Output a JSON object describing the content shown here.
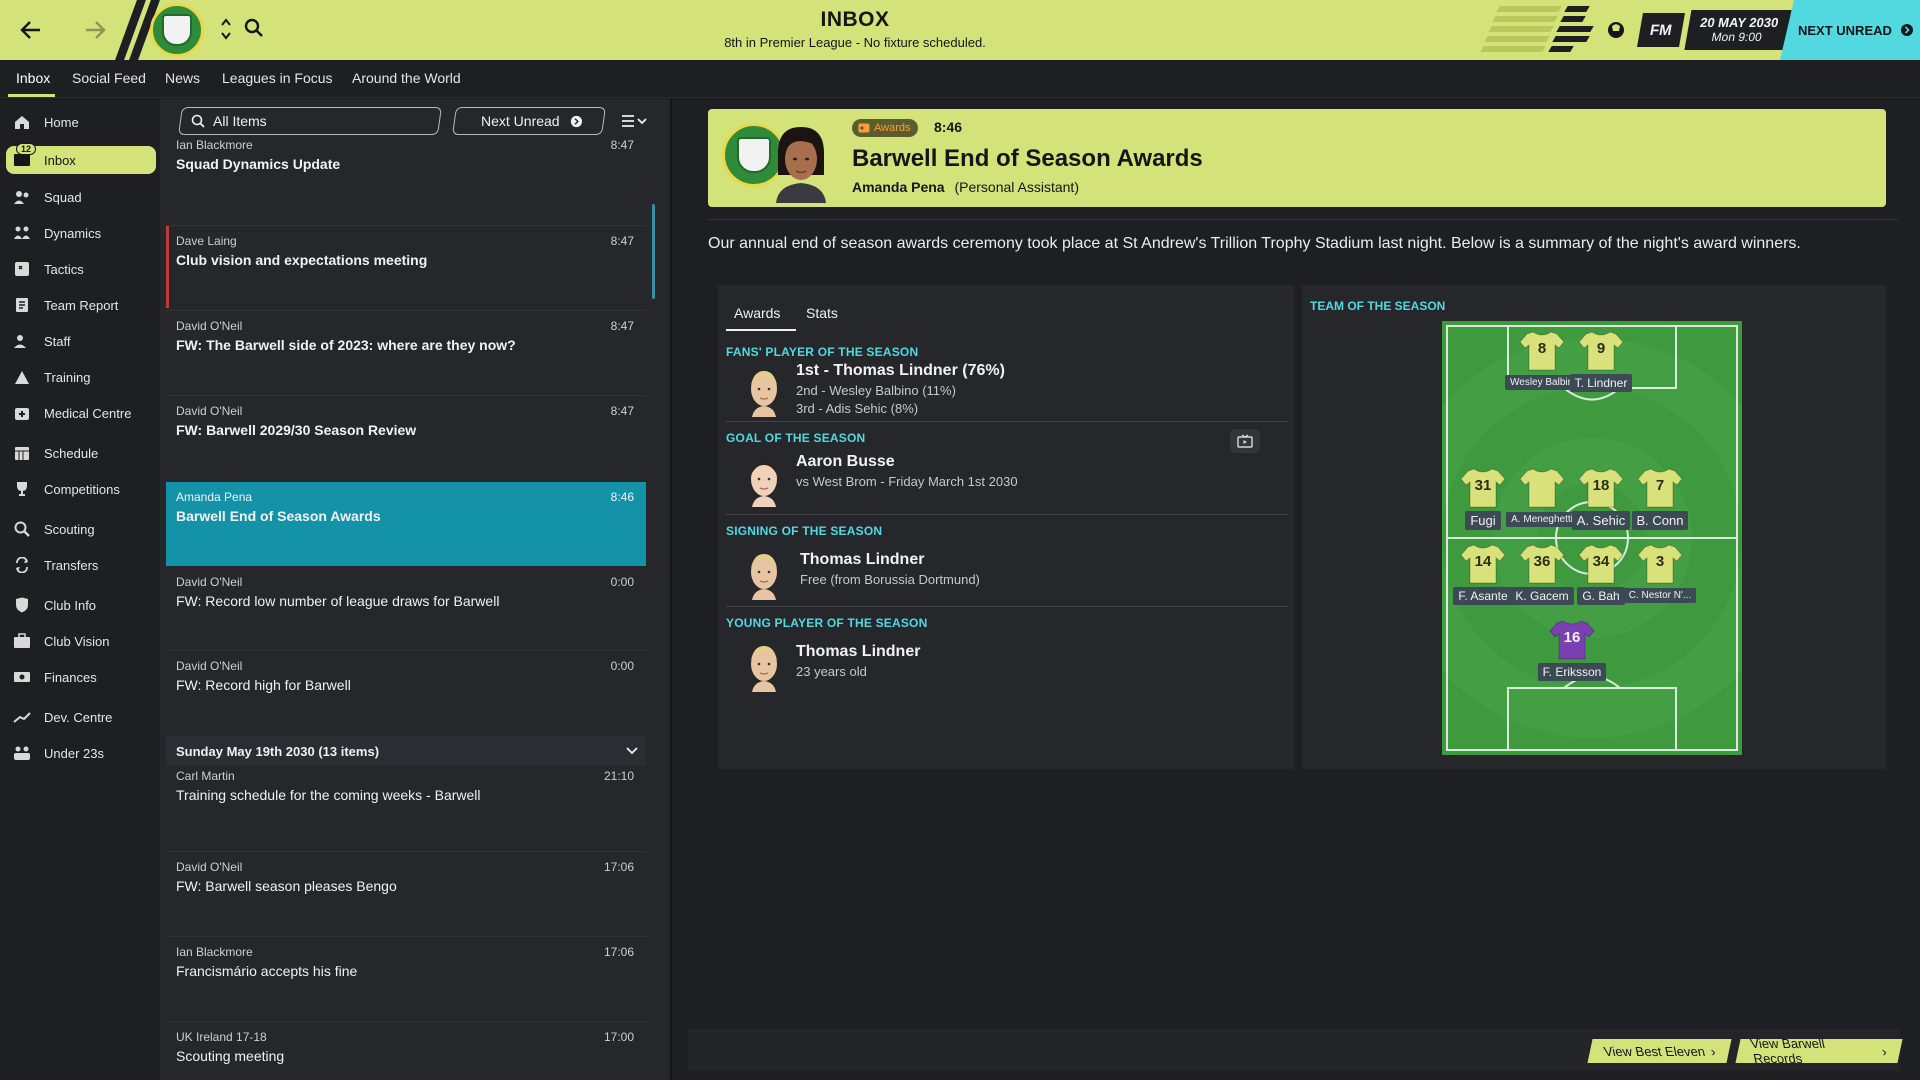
{
  "topbar": {
    "title": "INBOX",
    "subtitle": "8th in Premier League - No fixture scheduled.",
    "fm_label": "FM",
    "date": "20 MAY 2030",
    "time": "Mon 9:00",
    "next_unread": "NEXT UNREAD"
  },
  "tabs": [
    "Inbox",
    "Social Feed",
    "News",
    "Leagues in Focus",
    "Around the World"
  ],
  "sidebar": {
    "inbox_count": "12",
    "items": [
      {
        "label": "Home",
        "icon": "home-icon"
      },
      {
        "label": "Inbox",
        "icon": "inbox-icon"
      },
      {
        "label": "Squad",
        "icon": "squad-icon"
      },
      {
        "label": "Dynamics",
        "icon": "dynamics-icon"
      },
      {
        "label": "Tactics",
        "icon": "tactics-icon"
      },
      {
        "label": "Team Report",
        "icon": "report-icon"
      },
      {
        "label": "Staff",
        "icon": "staff-icon"
      },
      {
        "label": "Training",
        "icon": "training-icon"
      },
      {
        "label": "Medical Centre",
        "icon": "medical-icon"
      },
      {
        "label": "Schedule",
        "icon": "calendar-icon"
      },
      {
        "label": "Competitions",
        "icon": "trophy-icon"
      },
      {
        "label": "Scouting",
        "icon": "search-icon"
      },
      {
        "label": "Transfers",
        "icon": "transfers-icon"
      },
      {
        "label": "Club Info",
        "icon": "shield-icon"
      },
      {
        "label": "Club Vision",
        "icon": "briefcase-icon"
      },
      {
        "label": "Finances",
        "icon": "money-icon"
      },
      {
        "label": "Dev. Centre",
        "icon": "chart-icon"
      },
      {
        "label": "Under 23s",
        "icon": "group-icon"
      }
    ]
  },
  "list": {
    "filter_label": "All Items",
    "next_unread_label": "Next Unread",
    "messages": [
      {
        "from": "Ian Blackmore",
        "subject": "Squad Dynamics Update",
        "time": "8:47",
        "unread": true
      },
      {
        "from": "Dave Laing",
        "subject": "Club vision and expectations meeting",
        "time": "8:47",
        "unread": true
      },
      {
        "from": "David O'Neil",
        "subject": "FW: The Barwell side of 2023: where are they now?",
        "time": "8:47",
        "unread": true
      },
      {
        "from": "David O'Neil",
        "subject": "FW: Barwell 2029/30 Season Review",
        "time": "8:47",
        "unread": true
      },
      {
        "from": "Amanda Pena",
        "subject": "Barwell End of Season Awards",
        "time": "8:46",
        "unread": true
      },
      {
        "from": "David O'Neil",
        "subject": "FW: Record low number of league draws for Barwell",
        "time": "0:00",
        "unread": false
      },
      {
        "from": "David O'Neil",
        "subject": "FW: Record high for Barwell",
        "time": "0:00",
        "unread": false
      }
    ],
    "group_header": "Sunday May 19th 2030 (13 items)",
    "messages2": [
      {
        "from": "Carl Martin",
        "subject": "Training schedule for the coming weeks - Barwell",
        "time": "21:10"
      },
      {
        "from": "David O'Neil",
        "subject": "FW: Barwell season pleases Bengo",
        "time": "17:06"
      },
      {
        "from": "Ian Blackmore",
        "subject": "Francismário accepts his fine",
        "time": "17:06"
      },
      {
        "from": "UK Ireland 17-18",
        "subject": "Scouting meeting",
        "time": "17:00"
      }
    ]
  },
  "detail": {
    "tag": "Awards",
    "time": "8:46",
    "title": "Barwell End of Season Awards",
    "sender_name": "Amanda Pena",
    "sender_role": "(Personal Assistant)",
    "intro": "Our annual end of season awards ceremony took place at St Andrew's Trillion Trophy Stadium last night. Below is a summary of the night's award winners.",
    "sub_tabs": [
      "Awards",
      "Stats"
    ],
    "awards": [
      {
        "heading": "FANS' PLAYER OF THE SEASON",
        "main": "1st - Thomas Lindner (76%)",
        "lines": [
          "2nd - Wesley Balbino (11%)",
          "3rd - Adis Sehic (8%)"
        ]
      },
      {
        "heading": "GOAL OF THE SEASON",
        "main": "Aaron Busse",
        "lines": [
          "vs West Brom - Friday March 1st 2030"
        ]
      },
      {
        "heading": "SIGNING OF THE SEASON",
        "main": "Thomas Lindner",
        "lines": [
          "Free (from Borussia Dortmund)"
        ]
      },
      {
        "heading": "YOUNG PLAYER OF THE SEASON",
        "main": "Thomas Lindner",
        "lines": [
          "23 years old"
        ]
      }
    ],
    "team_title": "TEAM OF THE SEASON",
    "team": [
      {
        "num": "8",
        "name": "Wesley Balbino"
      },
      {
        "num": "9",
        "name": "T. Lindner"
      },
      {
        "num": "31",
        "name": "Fugi"
      },
      {
        "num": "",
        "name": "A. Meneghetti"
      },
      {
        "num": "18",
        "name": "A. Sehic"
      },
      {
        "num": "7",
        "name": "B. Conn"
      },
      {
        "num": "14",
        "name": "F. Asante"
      },
      {
        "num": "36",
        "name": "K. Gacem"
      },
      {
        "num": "34",
        "name": "G. Bah"
      },
      {
        "num": "3",
        "name": "C. Nestor N'..."
      },
      {
        "num": "16",
        "name": "F. Eriksson"
      }
    ],
    "view_best_eleven": "View Best Eleven",
    "view_records": "View Barwell Records"
  },
  "colors": {
    "accent": "#d4e27a",
    "cyan": "#52d9e0",
    "selected": "#1493a8",
    "pitch": "#3f9a3f"
  }
}
